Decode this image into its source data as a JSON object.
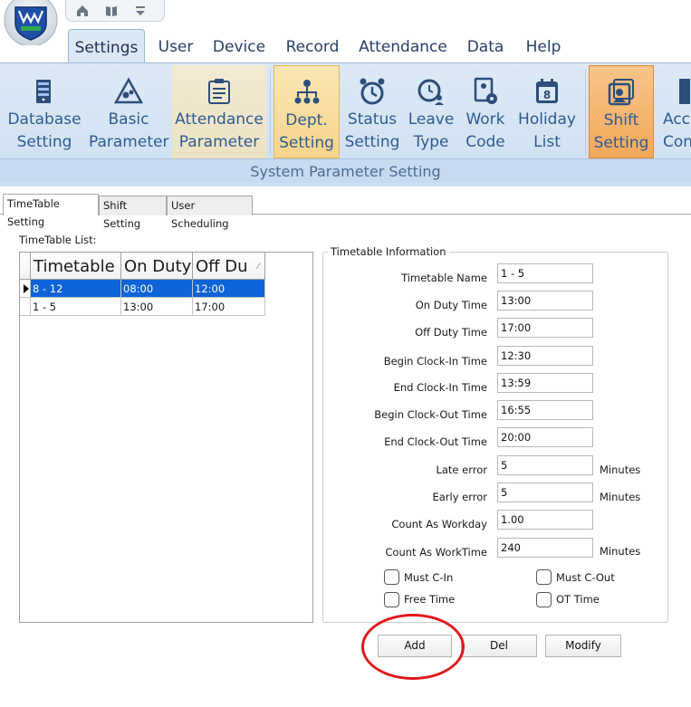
{
  "ribbon": {
    "tabs": [
      "Settings",
      "User",
      "Device",
      "Record",
      "Attendance",
      "Data",
      "Help"
    ],
    "active_tab": "Settings",
    "buttons": [
      {
        "line1": "Database",
        "line2": "Setting",
        "icon": "server-icon"
      },
      {
        "line1": "Basic",
        "line2": "Parameter",
        "icon": "triangle-gears-icon"
      },
      {
        "line1": "Attendance",
        "line2": "Parameter",
        "icon": "clipboard-icon"
      },
      {
        "line1": "Dept.",
        "line2": "Setting",
        "icon": "org-chart-icon"
      },
      {
        "line1": "Status",
        "line2": "Setting",
        "icon": "alarm-clock-icon"
      },
      {
        "line1": "Leave",
        "line2": "Type",
        "icon": "clock-person-icon"
      },
      {
        "line1": "Work",
        "line2": "Code",
        "icon": "document-gear-icon"
      },
      {
        "line1": "Holiday",
        "line2": "List",
        "icon": "calendar-icon"
      },
      {
        "line1": "Shift",
        "line2": "Setting",
        "icon": "shift-card-icon"
      },
      {
        "line1": "Acce",
        "line2": "Con",
        "icon": "door-icon"
      }
    ],
    "group_label": "System Parameter Setting"
  },
  "subtabs": [
    "TimeTable Setting",
    "Shift Setting",
    "User Scheduling"
  ],
  "timetable_list": {
    "label": "TimeTable List:",
    "columns": [
      "Timetable N",
      "On Duty",
      "Off Du"
    ],
    "rows": [
      {
        "name": "8 - 12",
        "on": "08:00",
        "off": "12:00",
        "selected": true
      },
      {
        "name": "1 - 5",
        "on": "13:00",
        "off": "17:00",
        "selected": false
      }
    ]
  },
  "info": {
    "title": "Timetable Information",
    "fields": [
      {
        "label": "Timetable Name",
        "value": "1 - 5",
        "unit": ""
      },
      {
        "label": "On Duty Time",
        "value": "13:00",
        "unit": ""
      },
      {
        "label": "Off Duty Time",
        "value": "17:00",
        "unit": ""
      },
      {
        "label": "Begin Clock-In Time",
        "value": "12:30",
        "unit": ""
      },
      {
        "label": "End Clock-In Time",
        "value": "13:59",
        "unit": ""
      },
      {
        "label": "Begin Clock-Out Time",
        "value": "16:55",
        "unit": ""
      },
      {
        "label": "End Clock-Out Time",
        "value": "20:00",
        "unit": ""
      },
      {
        "label": "Late error",
        "value": "5",
        "unit": "Minutes"
      },
      {
        "label": "Early error",
        "value": "5",
        "unit": "Minutes"
      },
      {
        "label": "Count As Workday",
        "value": "1.00",
        "unit": ""
      },
      {
        "label": "Count As WorkTime",
        "value": "240",
        "unit": "Minutes"
      }
    ],
    "checkboxes": {
      "must_cin": "Must C-In",
      "must_cout": "Must C-Out",
      "free_time": "Free Time",
      "ot_time": "OT Time"
    }
  },
  "actions": {
    "add": "Add",
    "del": "Del",
    "modify": "Modify"
  },
  "colors": {
    "selection": "#0f63d8",
    "annotation_circle": "#e0191b",
    "ribbon_highlight": "#f6d48a"
  }
}
